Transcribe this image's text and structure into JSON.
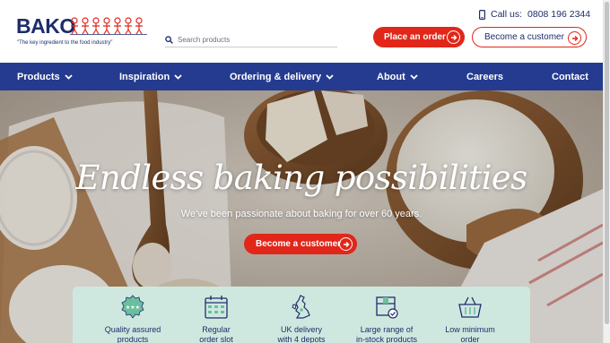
{
  "header": {
    "logo_text": "BAKO",
    "tagline": "\"The key ingredient to the food industry\"",
    "search_placeholder": "Search products",
    "call_label": "Call us:",
    "phone": "0808 196 2344",
    "place_order": "Place an order",
    "become_customer": "Become a customer"
  },
  "nav": {
    "items": [
      {
        "label": "Products",
        "dropdown": true
      },
      {
        "label": "Inspiration",
        "dropdown": true
      },
      {
        "label": "Ordering & delivery",
        "dropdown": true
      },
      {
        "label": "About",
        "dropdown": true
      },
      {
        "label": "Careers",
        "dropdown": false
      },
      {
        "label": "Contact",
        "dropdown": false
      }
    ]
  },
  "hero": {
    "title": "Endless baking possibilities",
    "subtitle": "We've been passionate about baking for over 60 years.",
    "cta": "Become a customer"
  },
  "benefits": [
    {
      "line1": "Quality assured",
      "line2": "products",
      "icon": "quality-badge-icon"
    },
    {
      "line1": "Regular",
      "line2": "order slot",
      "icon": "calendar-icon"
    },
    {
      "line1": "UK delivery",
      "line2": "with 4 depots",
      "icon": "uk-map-icon"
    },
    {
      "line1": "Large range of",
      "line2": "in-stock products",
      "icon": "box-check-icon"
    },
    {
      "line1": "Low minimum",
      "line2": "order",
      "icon": "basket-icon"
    }
  ],
  "colors": {
    "brand_blue": "#243b8f",
    "brand_red": "#e0271a",
    "benefit_bg": "#cfe8df"
  }
}
